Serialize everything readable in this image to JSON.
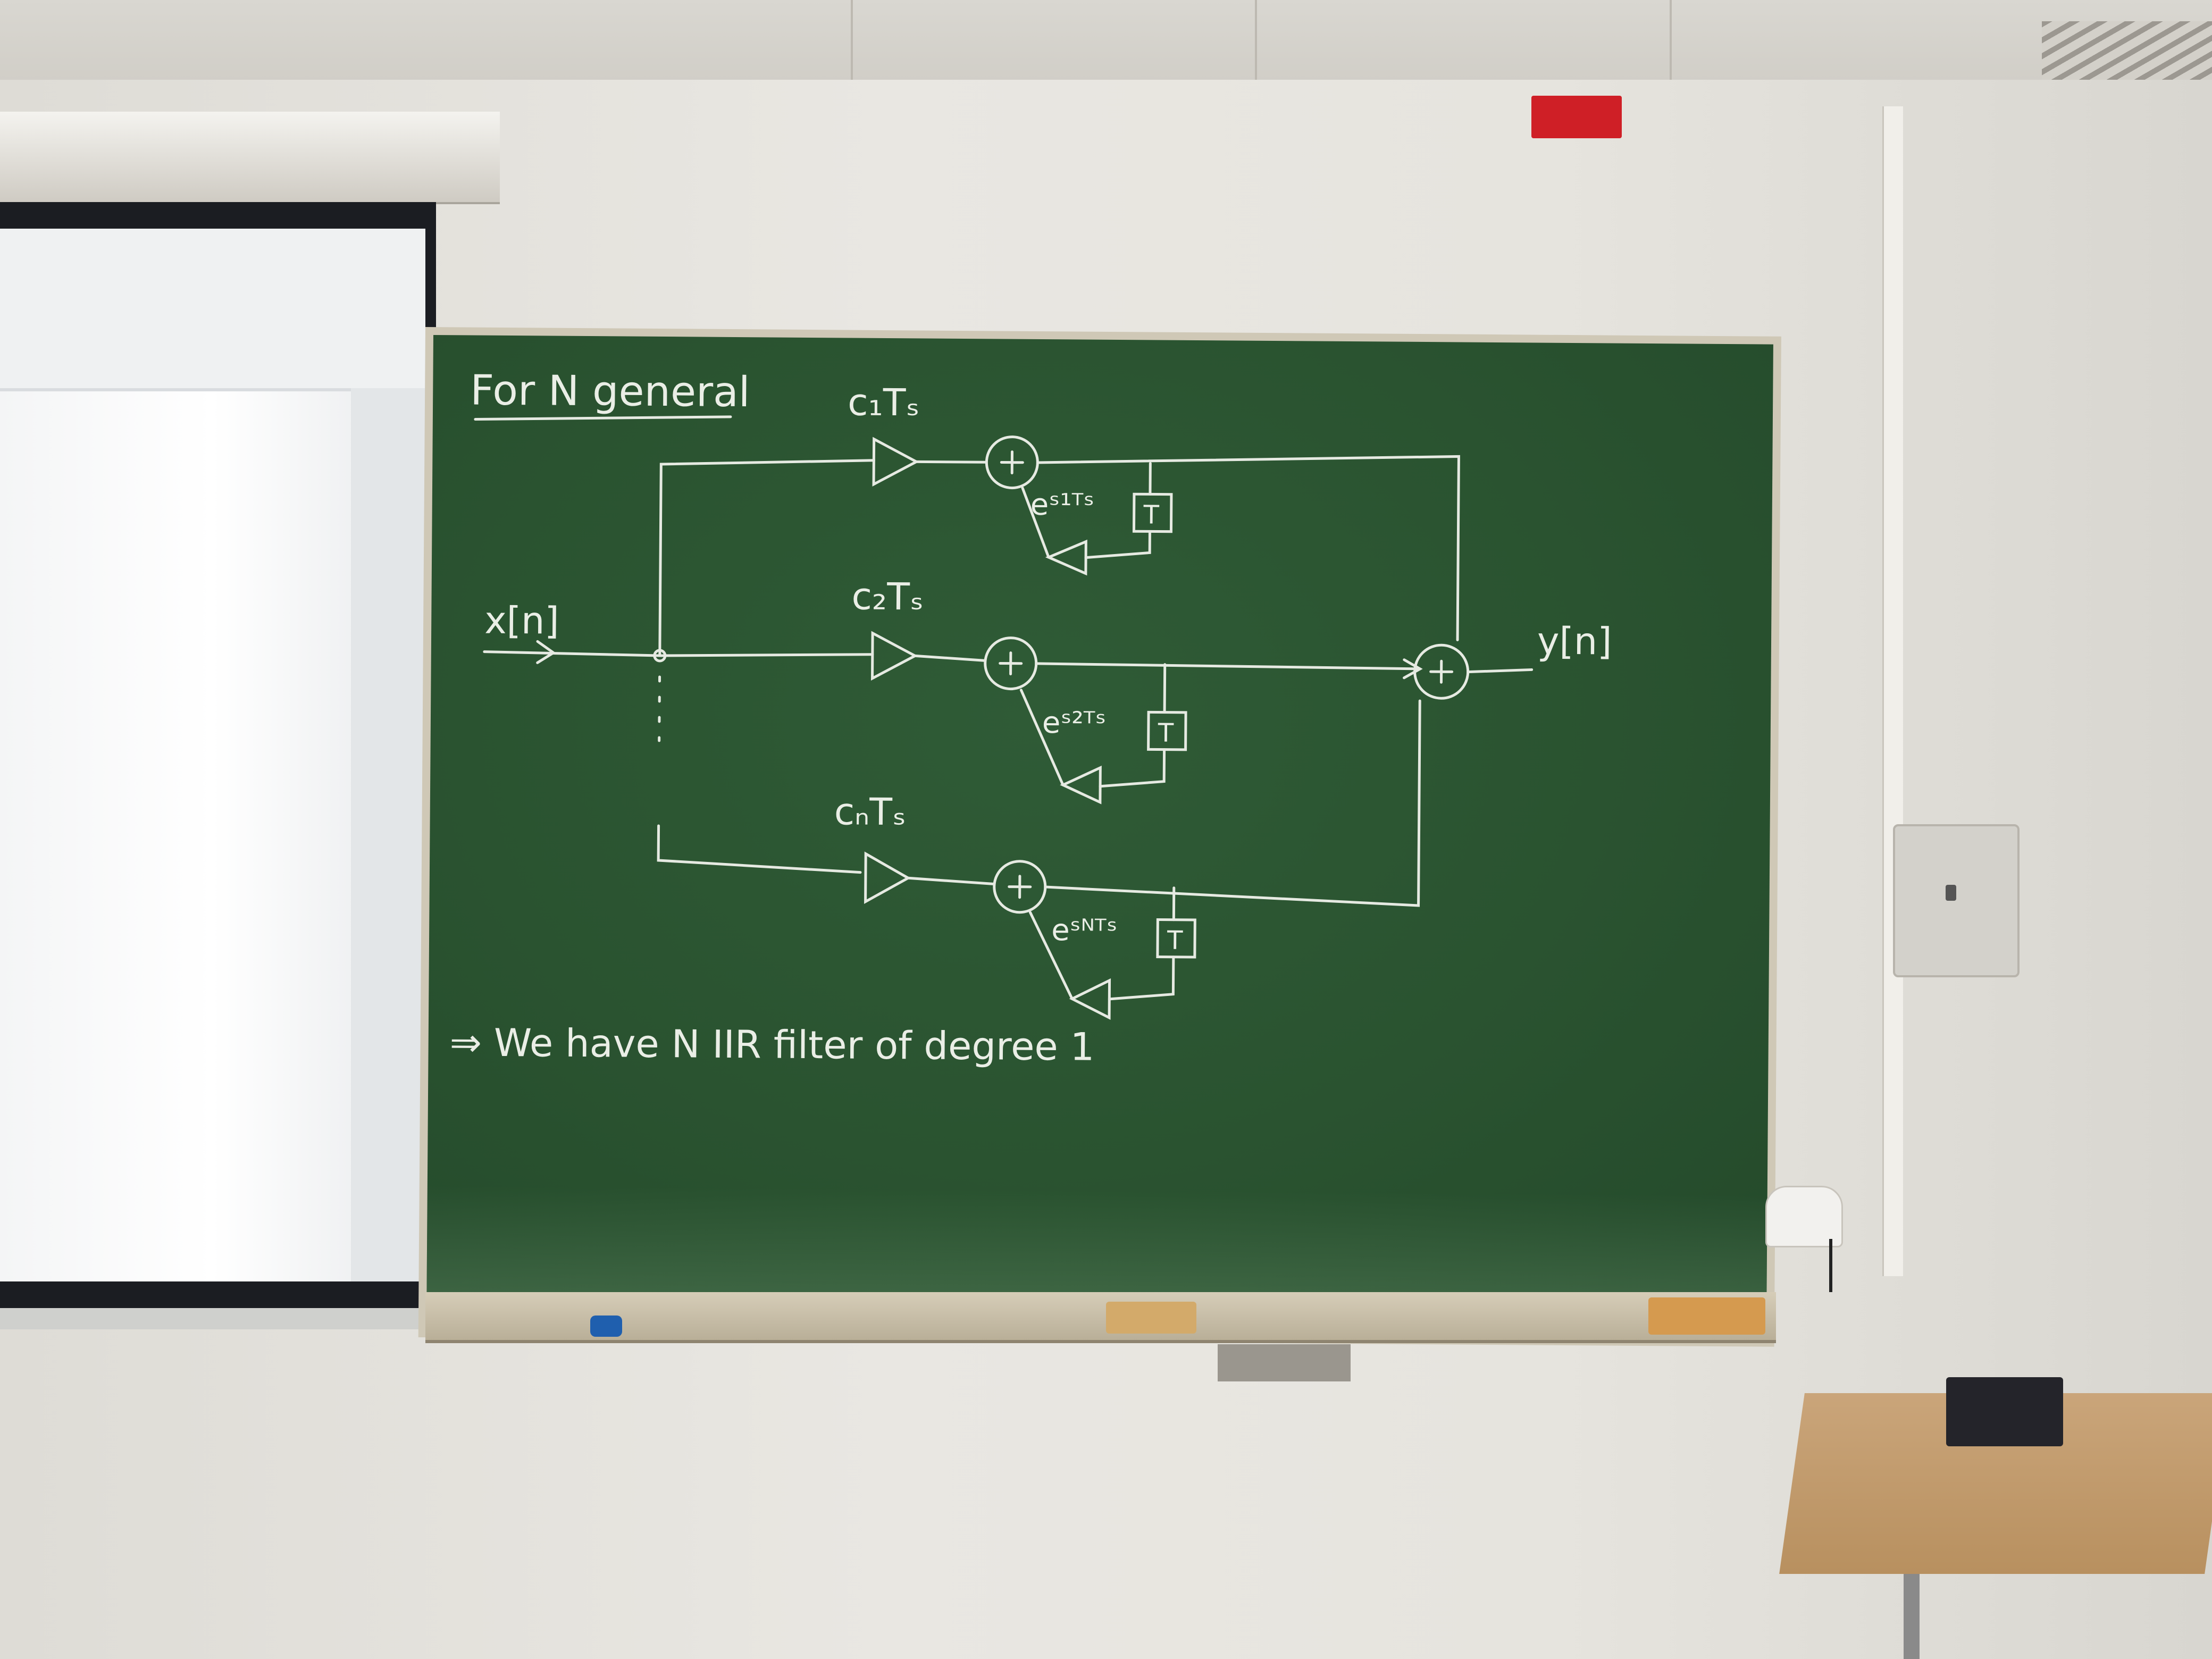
{
  "scene": {
    "description_colors": {
      "board": "#2a5330",
      "chalk": "#e8ece4",
      "wall": "#e6e4de",
      "exit_sign": "#cf1f26"
    }
  },
  "blackboard": {
    "heading": "For N general",
    "input_label": "x[n]",
    "output_label": "y[n]",
    "branches": [
      {
        "gain": "c₁Tₛ",
        "feedback": "eˢ¹ᵀˢ",
        "delay": "T"
      },
      {
        "gain": "c₂Tₛ",
        "feedback": "eˢ²ᵀˢ",
        "delay": "T"
      },
      {
        "gain": "cₙTₛ",
        "feedback": "eˢᴺᵀˢ",
        "delay": "T"
      }
    ],
    "conclusion": "⇒ We have N IIR filter of degree 1"
  }
}
